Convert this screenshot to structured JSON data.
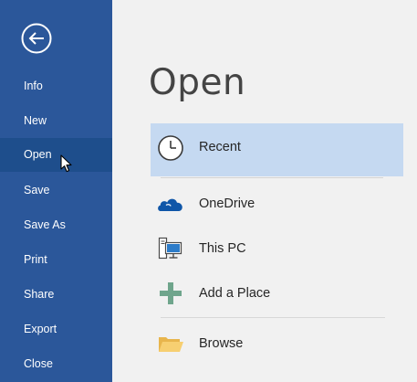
{
  "nav": {
    "items": [
      {
        "label": "Info"
      },
      {
        "label": "New"
      },
      {
        "label": "Open"
      },
      {
        "label": "Save"
      },
      {
        "label": "Save As"
      },
      {
        "label": "Print"
      },
      {
        "label": "Share"
      },
      {
        "label": "Export"
      },
      {
        "label": "Close"
      }
    ],
    "selected": "Open",
    "back_icon": "back-arrow-circle-icon"
  },
  "main": {
    "title": "Open",
    "places": [
      {
        "label": "Recent",
        "icon": "clock-icon",
        "selected": true
      },
      {
        "label": "OneDrive",
        "icon": "cloud-icon"
      },
      {
        "label": "This PC",
        "icon": "computer-icon"
      },
      {
        "label": "Add a Place",
        "icon": "plus-icon"
      },
      {
        "label": "Browse",
        "icon": "folder-icon"
      }
    ]
  },
  "colors": {
    "nav_background": "#2b579a",
    "nav_selected": "#1e4e8c",
    "content_background": "#f1f1f1",
    "recent_highlight": "#c5d9f1",
    "onedrive_blue": "#0f56a8",
    "add_place_green": "#6fa58c",
    "folder_yellow": "#f7cf71"
  }
}
